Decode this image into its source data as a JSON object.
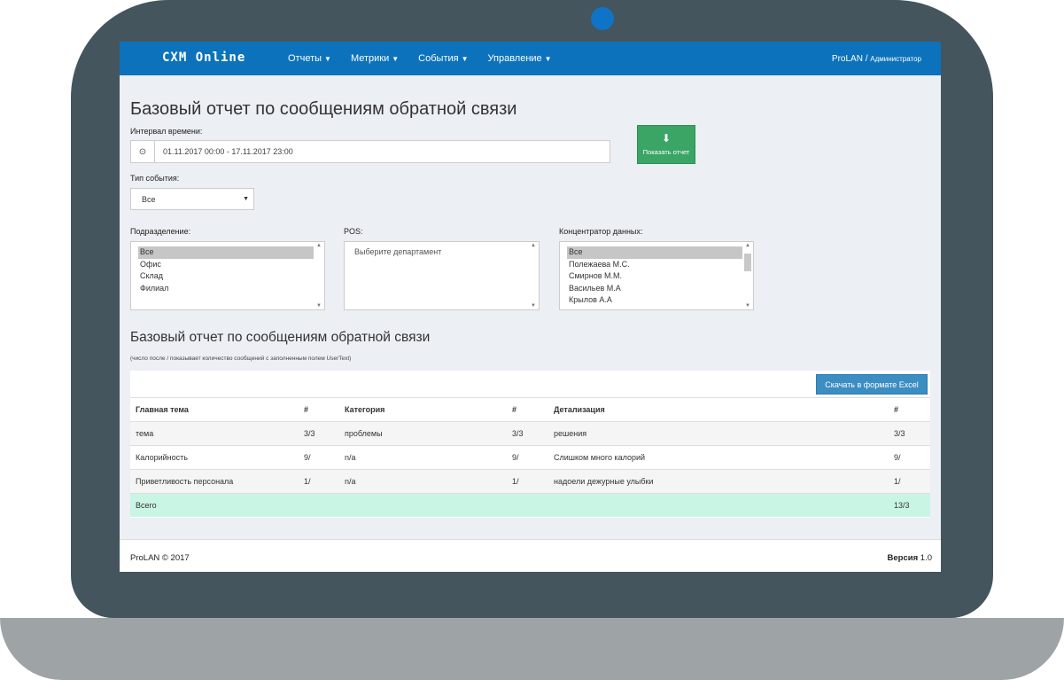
{
  "nav": {
    "logo": "CXM Online",
    "menu": [
      {
        "label": "Отчеты"
      },
      {
        "label": "Метрики"
      },
      {
        "label": "События"
      },
      {
        "label": "Управление"
      }
    ],
    "user": "ProLAN /",
    "role": "Администратор"
  },
  "page": {
    "title": "Базовый отчет по сообщениям обратной связи",
    "interval_label": "Интервал времени:",
    "interval_value": "01.11.2017 00:00 - 17.11.2017 23:00",
    "show_button": "Показать отчет",
    "event_type_label": "Тип события:",
    "event_type_value": "Все",
    "division_label": "Подразделение:",
    "division_options": [
      "Все",
      "Офис",
      "Склад",
      "Филиал"
    ],
    "pos_label": "POS:",
    "pos_placeholder": "Выберите департамент",
    "hub_label": "Концентратор данных:",
    "hub_options": [
      "Все",
      "Полежаева М.С.",
      "Смирнов М.М.",
      "Васильев М.А",
      "Крылов А.А"
    ]
  },
  "report": {
    "title": "Базовый отчет по сообщениям обратной связи",
    "note": "(число после / показывает количество сообщений с заполненным полем UserText)",
    "excel_button": "Скачать в формате Excel",
    "headers": [
      "Главная тема",
      "#",
      "Категория",
      "#",
      "Детализация",
      "#"
    ],
    "rows": [
      [
        "тема",
        "3/3",
        "проблемы",
        "3/3",
        "решения",
        "3/3"
      ],
      [
        "Калорийность",
        "9/",
        "n/a",
        "9/",
        "Слишком много калорий",
        "9/"
      ],
      [
        "Приветливость персонала",
        "1/",
        "n/a",
        "1/",
        "надоели дежурные улыбки",
        "1/"
      ]
    ],
    "total_label": "Всего",
    "total_value": "13/3"
  },
  "footer": {
    "copyright": "ProLAN © 2017",
    "version_label": "Версия",
    "version_value": "1.0"
  }
}
